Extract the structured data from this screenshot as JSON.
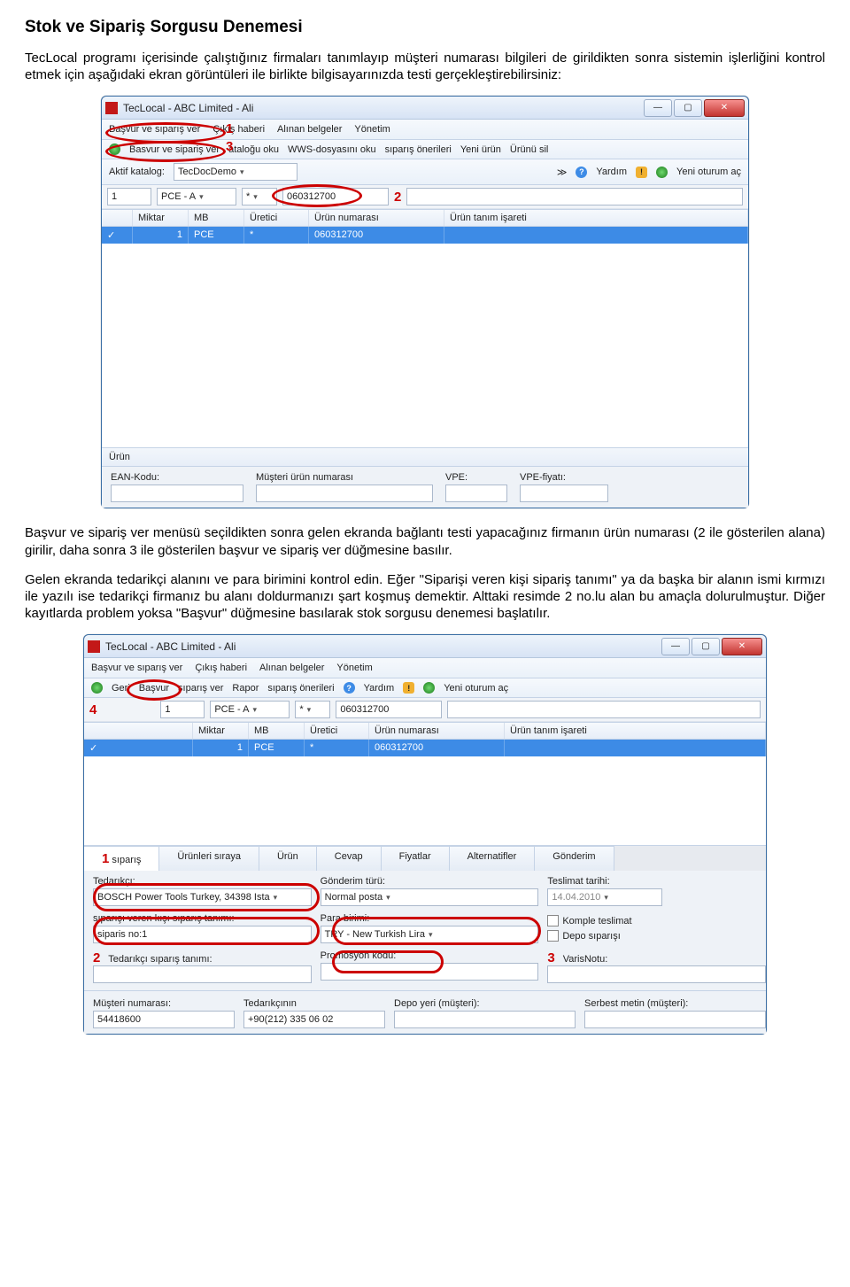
{
  "doc": {
    "title": "Stok ve Sipariş Sorgusu Denemesi",
    "p1": "TecLocal programı içerisinde çalıştığınız firmaları tanımlayıp müşteri numarası bilgileri de girildikten sonra sistemin işlerliğini kontrol etmek için aşağıdaki ekran görüntüleri ile birlikte bilgisayarınızda testi gerçekleştirebilirsiniz:",
    "p2": "Başvur ve sipariş ver menüsü seçildikten sonra gelen ekranda bağlantı testi yapacağınız firmanın ürün numarası (2 ile gösterilen alana) girilir, daha sonra 3 ile gösterilen başvur ve sipariş ver düğmesine basılır.",
    "p3": "Gelen ekranda tedarikçi alanını ve para birimini kontrol edin. Eğer \"Siparişi veren kişi sipariş tanımı\" ya da başka bir alanın ismi kırmızı ile yazılı ise tedarikçi firmanız bu alanı doldurmanızı şart koşmuş demektir. Alttaki resimde 2 no.lu alan bu amaçla dolurulmuştur. Diğer kayıtlarda problem yoksa \"Başvur\" düğmesine basılarak stok sorgusu denemesi başlatılır."
  },
  "win": {
    "title": "TecLocal - ABC Limited - Ali",
    "menu1": "Başvur ve sıparış ver",
    "menu2": "Çıkış haberi",
    "menu3": "Alınan belgeler",
    "menu4": "Yönetim",
    "tb_basvur": "Basvur ve sipariş ver",
    "tb_katalog": "ataloğu oku",
    "tb_wws": "WWS-dosyasını oku",
    "tb_oner": "sıparış önerileri",
    "tb_yeni": "Yeni ürün",
    "tb_sil": "Ürünü sil",
    "tb_geri": "Geri",
    "tb_basvur2": "Başvur",
    "tb_siparis": "sıparış ver",
    "tb_rapor": "Rapor",
    "aktif": "Aktif katalog:",
    "aktif_val": "TecDocDemo",
    "help": "Yardım",
    "yeni_oturum": "Yeni oturum aç",
    "active_row": {
      "a": "1",
      "b": "PCE - A",
      "c": "*",
      "d": "060312700"
    },
    "grid": {
      "h1": "Miktar",
      "h2": "MB",
      "h3": "Üretici",
      "h4": "Ürün numarası",
      "h5": "Ürün tanım işareti",
      "r1a": "",
      "r1b": "1",
      "r1c": "PCE",
      "r1d": "*",
      "r1e": "060312700"
    },
    "urun": "Ürün",
    "ean": "EAN-Kodu:",
    "mun": "Müşteri ürün numarası",
    "vpe": "VPE:",
    "vpef": "VPE-fiyatı:"
  },
  "win2": {
    "tabs": {
      "t1": "sıparış",
      "t2": "Ürünleri sıraya",
      "t3": "Ürün",
      "t4": "Cevap",
      "t5": "Fiyatlar",
      "t6": "Alternatifler",
      "t7": "Gönderim"
    },
    "tedarikci": "Tedarıkçı:",
    "tedarikci_val": "BOSCH Power Tools Turkey, 34398 Ista",
    "gonderim": "Gönderim türü:",
    "gonderim_val": "Normal posta",
    "teslimat": "Teslimat tarihi:",
    "teslimat_val": "14.04.2010",
    "svk": "sıparışı veren kışı sıparış tanımı:",
    "svk_val": "siparis no:1",
    "para": "Para birimi:",
    "para_val": "TRY - New Turkish Lira",
    "komple": "Komple teslimat",
    "depo": "Depo sıparışı",
    "tst": "Tedarıkçı sıparış tanımı:",
    "promo": "Promosyon kodu:",
    "varis": "VarisNotu:",
    "musteri": "Müşteri numarası:",
    "musteri_val": "54418600",
    "tk": "Tedarıkçının",
    "tk_val": "+90(212) 335 06 02",
    "dym": "Depo yeri (müşteri):",
    "sm": "Serbest metin (müşteri):",
    "marks": {
      "m1": "1",
      "m2": "2",
      "m3": "3",
      "m4": "4"
    }
  },
  "marks": {
    "m1": "1",
    "m2": "2",
    "m3": "3"
  }
}
